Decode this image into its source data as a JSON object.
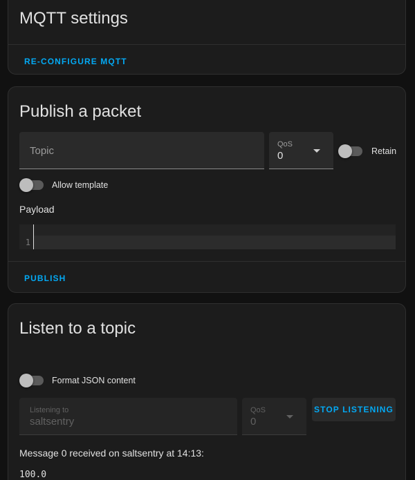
{
  "mqtt_settings": {
    "title": "MQTT settings",
    "reconfigure_label": "RE-CONFIGURE MQTT"
  },
  "publish": {
    "title": "Publish a packet",
    "topic_placeholder": "Topic",
    "qos_label": "QoS",
    "qos_value": "0",
    "retain_label": "Retain",
    "allow_template_label": "Allow template",
    "payload_label": "Payload",
    "editor_line_number": "1",
    "publish_label": "PUBLISH"
  },
  "listen": {
    "title": "Listen to a topic",
    "format_json_label": "Format JSON content",
    "listening_to_label": "Listening to",
    "listening_to_value": "saltsentry",
    "qos_label": "QoS",
    "qos_value": "0",
    "stop_label": "STOP LISTENING",
    "message_text": "Message 0 received on saltsentry at 14:13:",
    "message_payload": "100.0"
  },
  "switches": {
    "retain": false,
    "allow_template": false,
    "format_json": false
  },
  "colors": {
    "accent": "#03a9f4",
    "card_background": "#1c1c1c",
    "page_background": "#111111"
  }
}
